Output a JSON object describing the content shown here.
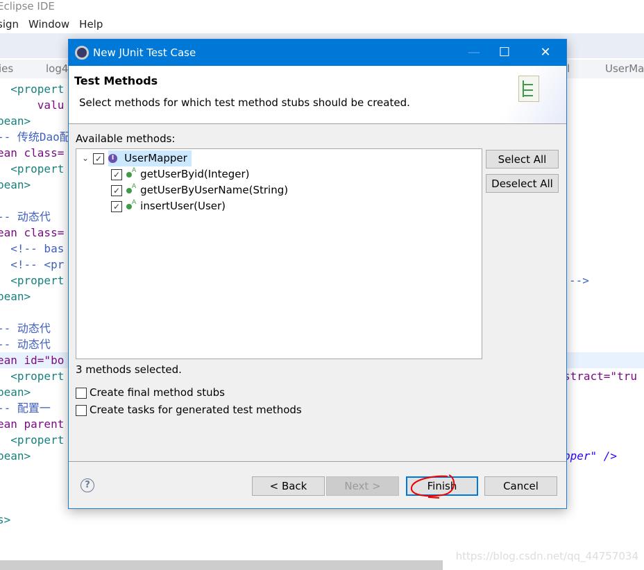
{
  "app": {
    "title": "Eclipse IDE",
    "menu": [
      "sign",
      "Window",
      "Help"
    ]
  },
  "editor_tabs": [
    "ies",
    "log4",
    "l",
    "UserMa"
  ],
  "code_lines": [
    {
      "text": "  <propert",
      "cls": "teal"
    },
    {
      "text": "      valu",
      "cls": "purp"
    },
    {
      "text": "bean>",
      "cls": "teal"
    },
    {
      "text": "-- 传统Dao配",
      "cls": "blue"
    },
    {
      "text": "ean class=",
      "cls": "purp"
    },
    {
      "text": "  <propert",
      "cls": "teal"
    },
    {
      "text": "bean>",
      "cls": "teal"
    },
    {
      "text": "",
      "cls": ""
    },
    {
      "text": "-- 动态代",
      "cls": "blue"
    },
    {
      "text": "ean class=",
      "cls": "purp"
    },
    {
      "text": "  <!-- bas",
      "cls": "blue"
    },
    {
      "text": "  <!-- <pr",
      "cls": "blue"
    },
    {
      "text": "  <propert",
      "cls": "teal"
    },
    {
      "text": "bean>",
      "cls": "teal"
    },
    {
      "text": "",
      "cls": ""
    },
    {
      "text": "-- 动态代",
      "cls": "blue"
    },
    {
      "text": "-- 动态代",
      "cls": "blue"
    },
    {
      "text": "ean id=\"bo",
      "cls": "purp"
    },
    {
      "text": "  <propert",
      "cls": "teal"
    },
    {
      "text": "bean>",
      "cls": "teal"
    },
    {
      "text": "-- 配置一",
      "cls": "blue"
    },
    {
      "text": "ean parent",
      "cls": "purp"
    },
    {
      "text": "  <propert",
      "cls": "teal"
    },
    {
      "text": "bean>",
      "cls": "teal"
    },
    {
      "text": "",
      "cls": ""
    },
    {
      "text": "",
      "cls": ""
    },
    {
      "text": "",
      "cls": ""
    },
    {
      "text": "s>",
      "cls": "teal"
    }
  ],
  "code_right": {
    "line12": "-->",
    "line18": "stract=\"tru",
    "line23": "pper\" />"
  },
  "watermark": "https://blog.csdn.net/qq_44757034",
  "dialog": {
    "title": "New JUnit Test Case",
    "header_title": "Test Methods",
    "header_desc": "Select methods for which test method stubs should be created.",
    "available_label": "Available methods:",
    "tree": {
      "root": {
        "label": "UserMapper",
        "checked": true,
        "expanded": true
      },
      "methods": [
        {
          "label": "getUserByid(Integer)",
          "checked": true
        },
        {
          "label": "getUserByUserName(String)",
          "checked": true
        },
        {
          "label": "insertUser(User)",
          "checked": true
        }
      ]
    },
    "select_all": "Select All",
    "deselect_all": "Deselect All",
    "status": "3 methods selected.",
    "opt_final": {
      "label": "Create final method stubs",
      "checked": false
    },
    "opt_tasks": {
      "label": "Create tasks for generated test methods",
      "checked": false
    },
    "back": "< Back",
    "next": "Next >",
    "finish": "Finish",
    "cancel": "Cancel",
    "accent": "#0078d7"
  }
}
